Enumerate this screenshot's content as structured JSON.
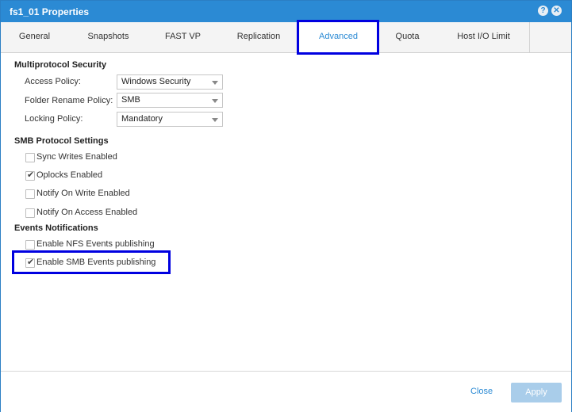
{
  "window": {
    "title": "fs1_01 Properties"
  },
  "titlebar_icons": {
    "help": "?",
    "close": "✕"
  },
  "tabs": [
    {
      "label": "General"
    },
    {
      "label": "Snapshots"
    },
    {
      "label": "FAST VP"
    },
    {
      "label": "Replication"
    },
    {
      "label": "Advanced"
    },
    {
      "label": "Quota"
    },
    {
      "label": "Host I/O Limit"
    }
  ],
  "active_tab": "Advanced",
  "multiprotocol": {
    "heading": "Multiprotocol Security",
    "access_policy": {
      "label": "Access Policy:",
      "value": "Windows Security"
    },
    "folder_rename_policy": {
      "label": "Folder Rename Policy:",
      "value": "SMB"
    },
    "locking_policy": {
      "label": "Locking Policy:",
      "value": "Mandatory"
    }
  },
  "smb": {
    "heading": "SMB Protocol Settings",
    "options": [
      {
        "label": "Sync Writes Enabled",
        "checked": false
      },
      {
        "label": "Oplocks Enabled",
        "checked": true
      },
      {
        "label": "Notify On Write Enabled",
        "checked": false
      },
      {
        "label": "Notify On Access Enabled",
        "checked": false
      }
    ]
  },
  "events": {
    "heading": "Events Notifications",
    "options": [
      {
        "label": "Enable NFS Events publishing",
        "checked": false
      },
      {
        "label": "Enable SMB Events publishing",
        "checked": true
      }
    ]
  },
  "footer": {
    "close_label": "Close",
    "apply_label": "Apply"
  },
  "colors": {
    "accent": "#2b8ad4",
    "highlight": "#0000e0",
    "apply_disabled": "#a9cdea"
  },
  "check_glyph": "✔"
}
